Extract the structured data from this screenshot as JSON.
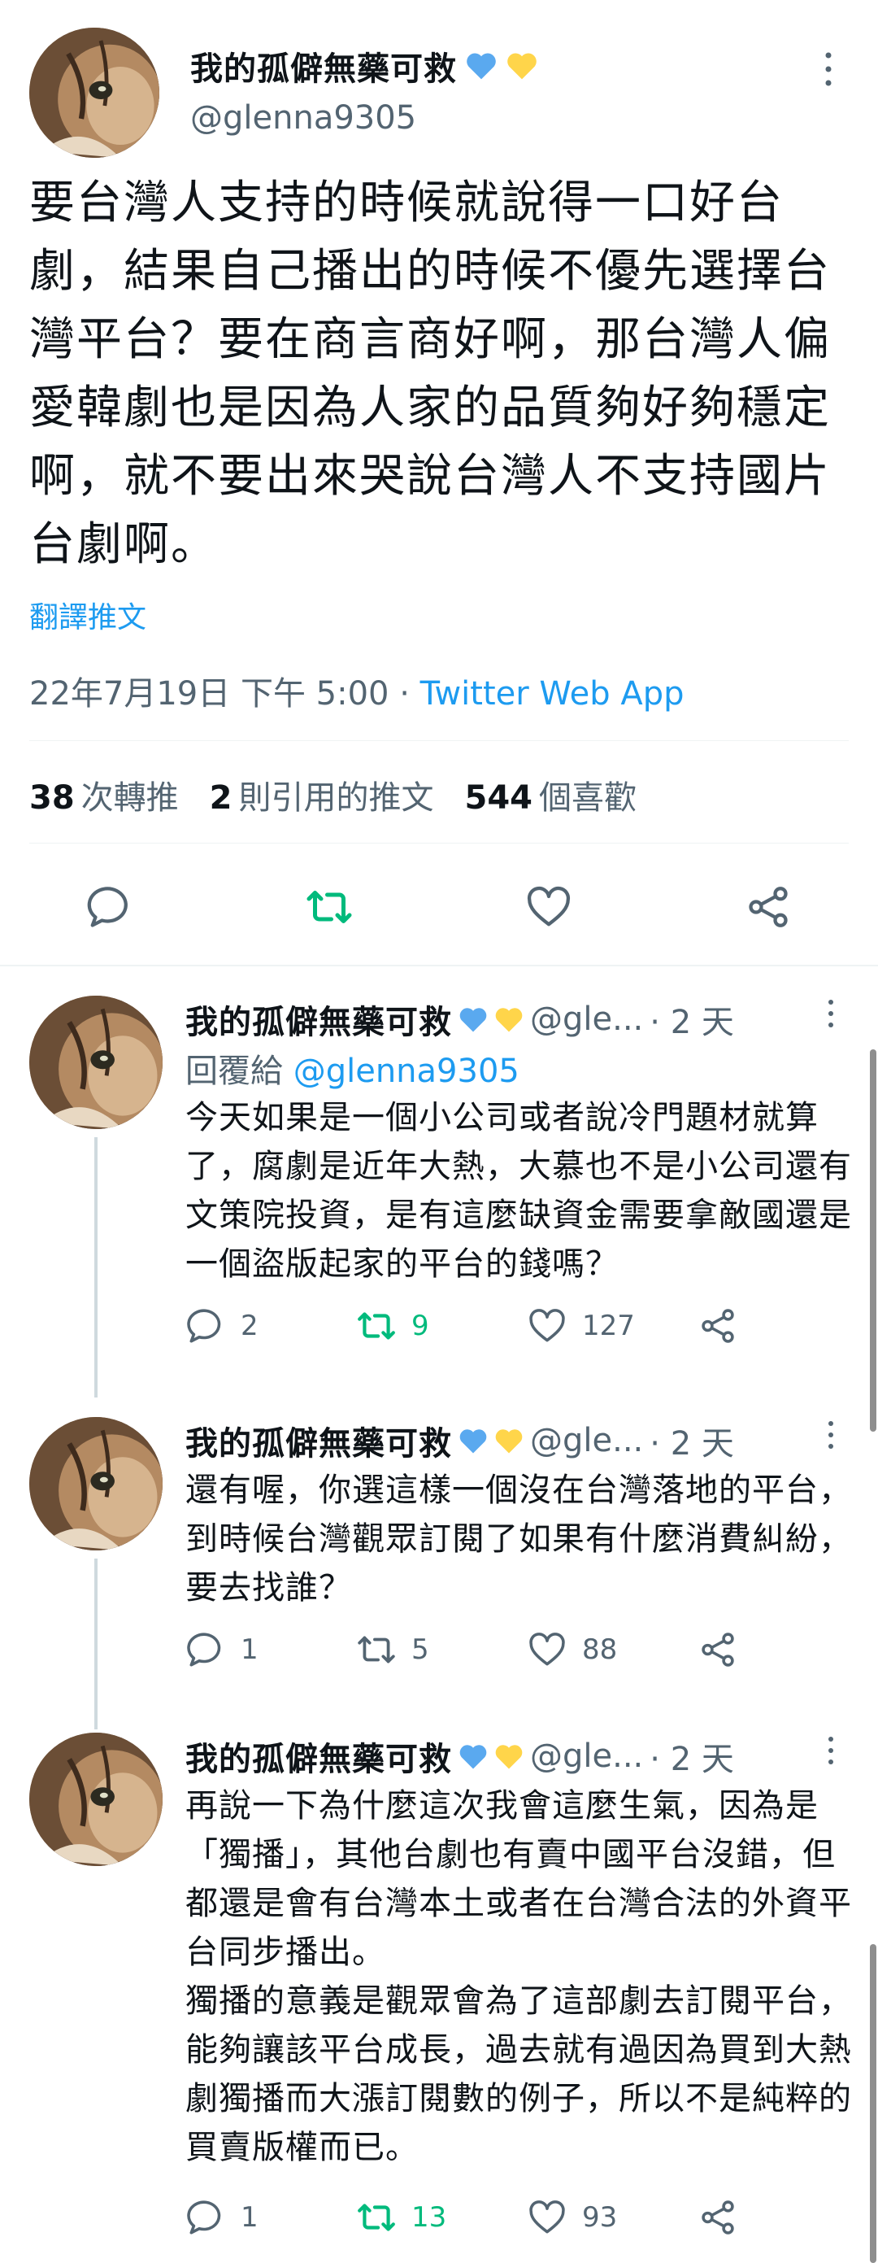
{
  "main_tweet": {
    "display_name": "我的孤僻無藥可救",
    "handle": "@glenna9305",
    "text": "要台灣人支持的時候就說得一口好台劇，結果自己播出的時候不優先選擇台灣平台？要在商言商好啊，那台灣人偏愛韓劇也是因為人家的品質夠好夠穩定啊，就不要出來哭說台灣人不支持國片台劇啊。",
    "translate_label": "翻譯推文",
    "timestamp": "22年7月19日 下午 5:00",
    "separator": " · ",
    "source": "Twitter Web App",
    "stats": {
      "retweets_count": "38",
      "retweets_label": "次轉推",
      "quotes_count": "2",
      "quotes_label": "則引用的推文",
      "likes_count": "544",
      "likes_label": "個喜歡"
    }
  },
  "replies": [
    {
      "display_name": "我的孤僻無藥可救",
      "handle": "@gle...",
      "time": "· 2 天",
      "replying_prefix": "回覆給 ",
      "replying_to": "@glenna9305",
      "text": "今天如果是一個小公司或者說冷門題材就算了，腐劇是近年大熱，大慕也不是小公司還有文策院投資，是有這麼缺資金需要拿敵國還是一個盜版起家的平台的錢嗎？",
      "replies": "2",
      "retweets": "9",
      "likes": "127",
      "retweeted": true
    },
    {
      "display_name": "我的孤僻無藥可救",
      "handle": "@gle...",
      "time": "· 2 天",
      "text": "還有喔，你選這樣一個沒在台灣落地的平台，到時候台灣觀眾訂閱了如果有什麼消費糾紛，要去找誰？",
      "replies": "1",
      "retweets": "5",
      "likes": "88",
      "retweeted": false
    },
    {
      "display_name": "我的孤僻無藥可救",
      "handle": "@gle...",
      "time": "· 2 天",
      "text_line1": "再說一下為什麼這次我會這麼生氣，因為是「獨播」，其他台劇也有賣中國平台沒錯，但都還是會有台灣本土或者在台灣合法的外資平台同步播出。",
      "text_line2": "獨播的意義是觀眾會為了這部劇去訂閱平台，能夠讓該平台成長，過去就有過因為買到大熱劇獨播而大漲訂閱數的例子，所以不是純粹的買賣版權而已。",
      "replies": "1",
      "retweets": "13",
      "likes": "93",
      "retweeted": true
    }
  ],
  "icons": {
    "verified_hearts": [
      "blue-heart-icon",
      "yellow-heart-icon"
    ],
    "reply": "comment-icon",
    "retweet": "retweet-icon",
    "like": "heart-icon",
    "share": "share-icon",
    "more": "more-vertical-icon"
  },
  "colors": {
    "accent": "#1d9bf0",
    "retweet_green": "#00ba7c",
    "secondary_text": "#536471",
    "blue_heart": "#5aa9ef",
    "yellow_heart": "#ffd54a"
  }
}
